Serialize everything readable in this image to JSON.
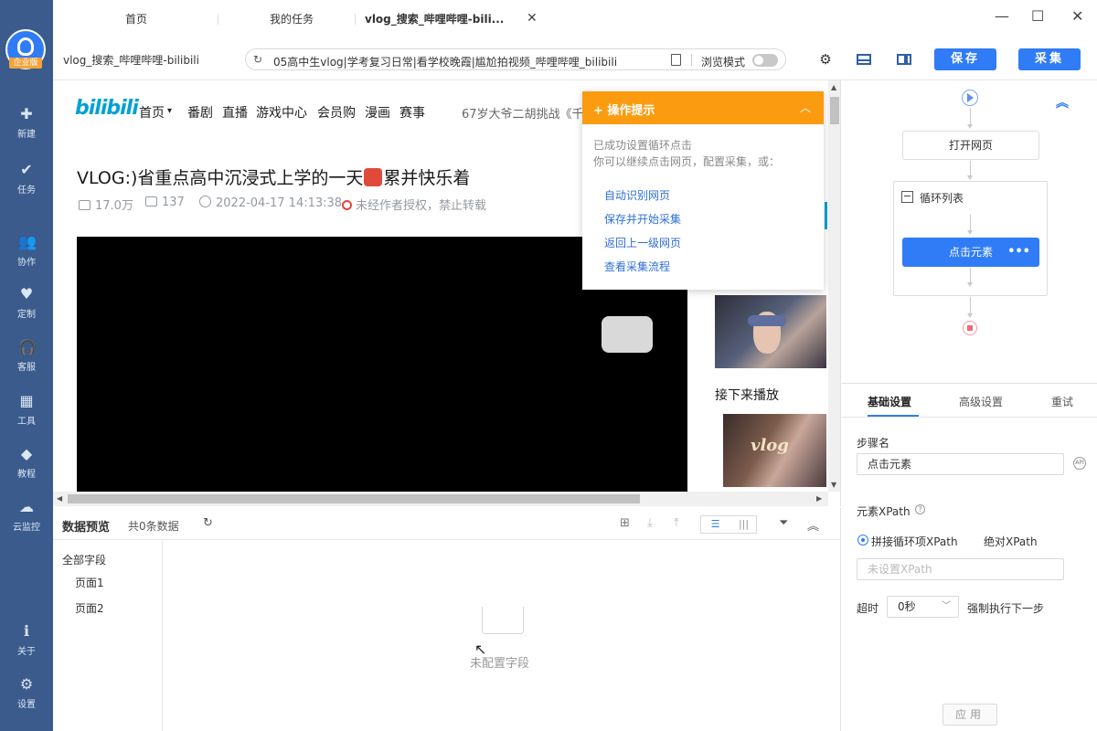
{
  "leftnav": {
    "logo_badge": "企业版",
    "items": [
      {
        "label": "新建",
        "icon": "plus-square-icon",
        "glyph": "✚"
      },
      {
        "label": "任务",
        "icon": "bookmark-icon",
        "glyph": "✔"
      },
      {
        "label": "协作",
        "icon": "people-icon",
        "glyph": "👥"
      },
      {
        "label": "定制",
        "icon": "diamond-heart-icon",
        "glyph": "♥"
      },
      {
        "label": "客服",
        "icon": "headset-icon",
        "glyph": "🎧"
      },
      {
        "label": "工具",
        "icon": "toolbox-icon",
        "glyph": "▦"
      },
      {
        "label": "教程",
        "icon": "graduation-cap-icon",
        "glyph": "◆"
      },
      {
        "label": "云监控",
        "icon": "cloud-pulse-icon",
        "glyph": "☁"
      },
      {
        "label": "关于",
        "icon": "info-icon",
        "glyph": "ℹ"
      },
      {
        "label": "设置",
        "icon": "gear-icon",
        "glyph": "⚙"
      }
    ]
  },
  "tabs": {
    "home": "首页",
    "my_tasks": "我的任务",
    "active": "vlog_搜索_哔哩哔哩-bili...",
    "close": "✕"
  },
  "window": {
    "minimize": "—",
    "maximize": "☐",
    "close": "✕"
  },
  "toolbar": {
    "page_title": "vlog_搜索_哔哩哔哩-bilibili",
    "url": "05高中生vlog|学考复习日常|看学校晚霞|尴尬拍视频_哔哩哔哩_bilibili",
    "browse_mode": "浏览模式",
    "save": "保存",
    "collect": "采集"
  },
  "bilibili": {
    "logo": "bilibili",
    "nav": [
      "首页",
      "番剧",
      "直播",
      "游戏中心",
      "会员购",
      "漫画",
      "赛事"
    ],
    "hot_search": "67岁大爷二胡挑战《千",
    "title_before": "VLOG:)省重点高中沉浸式上学的一天",
    "title_after": "累并快乐着",
    "views": "17.0万",
    "comments": "137",
    "date": "2022-04-17 14:13:38",
    "copyright": "未经作者授权，禁止转载",
    "next_up": "接下来播放",
    "thumb2_text": "vlog"
  },
  "tip": {
    "title": "操作提示",
    "line1": "已成功设置循环点击",
    "line2": "你可以继续点击网页，配置采集，或：",
    "links": [
      "自动识别网页",
      "保存并开始采集",
      "返回上一级网页",
      "查看采集流程"
    ]
  },
  "preview": {
    "title": "数据预览",
    "count": "共0条数据",
    "fields_all": "全部字段",
    "fields": [
      "页面1",
      "页面2"
    ],
    "empty": "未配置字段"
  },
  "flow": {
    "open_page": "打开网页",
    "loop_list": "循环列表",
    "click_element": "点击元素",
    "more": "•••"
  },
  "settings": {
    "tabs": [
      "基础设置",
      "高级设置",
      "重试"
    ],
    "step_name_label": "步骤名",
    "step_name_value": "点击元素",
    "api": "API",
    "xpath_label": "元素XPath",
    "xpath_options": [
      "拼接循环项XPath",
      "绝对XPath"
    ],
    "xpath_placeholder": "未设置XPath",
    "timeout_label": "超时",
    "timeout_value": "0秒",
    "force_next": "强制执行下一步",
    "apply": "应用"
  },
  "colors": {
    "nav_bg": "#3a5b8c",
    "accent": "#2f7cf6",
    "tip_orange": "#fb9b10",
    "bili_blue": "#00a1d6"
  }
}
